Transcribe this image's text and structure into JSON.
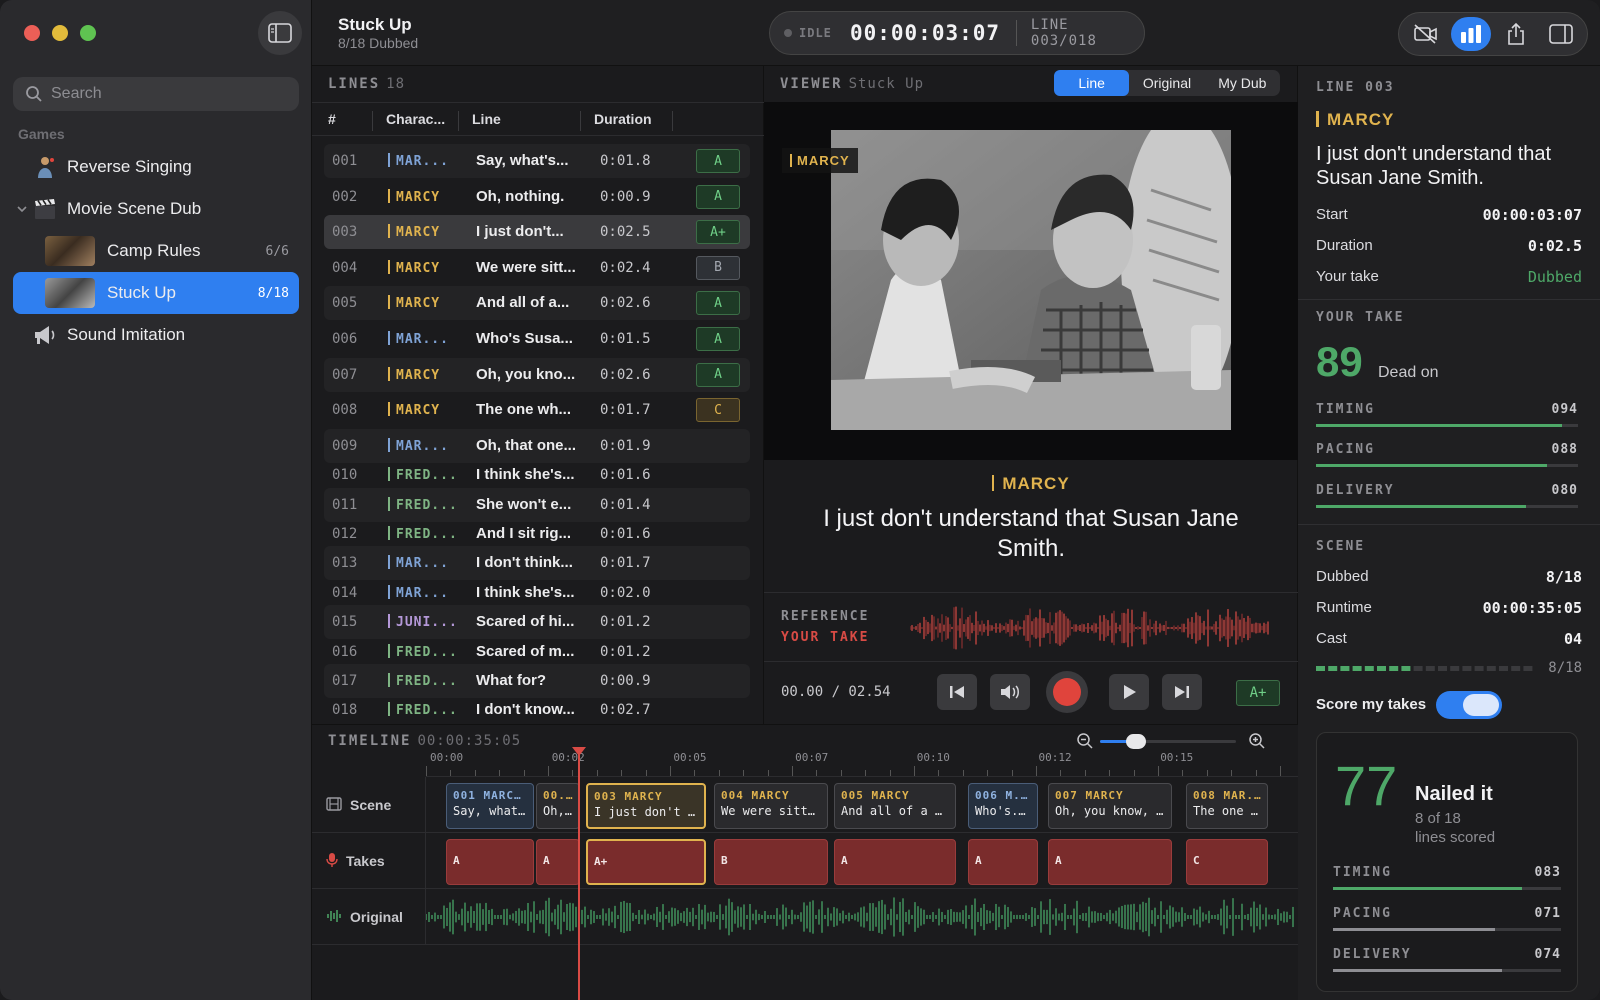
{
  "sidebar": {
    "search_placeholder": "Search",
    "section_title": "Games",
    "items": [
      {
        "label": "Reverse Singing",
        "icon": "singer-icon"
      },
      {
        "label": "Movie Scene Dub",
        "icon": "clapperboard-icon",
        "expanded": true
      },
      {
        "label": "Camp Rules",
        "count": "6/6"
      },
      {
        "label": "Stuck Up",
        "count": "8/18",
        "selected": true
      },
      {
        "label": "Sound Imitation",
        "icon": "megaphone-icon"
      }
    ]
  },
  "header": {
    "title": "Stuck Up",
    "subtitle": "8/18 Dubbed",
    "status": "IDLE",
    "timecode": "00:00:03:07",
    "line_counter": "LINE 003/018"
  },
  "lines": {
    "title": "LINES",
    "count": "18",
    "columns": [
      "#",
      "Charac...",
      "Line",
      "Duration"
    ],
    "rows": [
      {
        "num": "001",
        "character": "MAR...",
        "cls": "c-marb",
        "line": "Say, what's...",
        "duration": "0:01.8",
        "grade": "A"
      },
      {
        "num": "002",
        "character": "MARCY",
        "cls": "c-marcy",
        "line": "Oh, nothing.",
        "duration": "0:00.9",
        "grade": "A"
      },
      {
        "num": "003",
        "character": "MARCY",
        "cls": "c-marcy",
        "line": "I just don't...",
        "duration": "0:02.5",
        "grade": "A+"
      },
      {
        "num": "004",
        "character": "MARCY",
        "cls": "c-marcy",
        "line": "We were sitt...",
        "duration": "0:02.4",
        "grade": "B"
      },
      {
        "num": "005",
        "character": "MARCY",
        "cls": "c-marcy",
        "line": "And all of a...",
        "duration": "0:02.6",
        "grade": "A"
      },
      {
        "num": "006",
        "character": "MAR...",
        "cls": "c-marb",
        "line": "Who's Susa...",
        "duration": "0:01.5",
        "grade": "A"
      },
      {
        "num": "007",
        "character": "MARCY",
        "cls": "c-marcy",
        "line": "Oh, you kno...",
        "duration": "0:02.6",
        "grade": "A"
      },
      {
        "num": "008",
        "character": "MARCY",
        "cls": "c-marcy",
        "line": "The one wh...",
        "duration": "0:01.7",
        "grade": "C"
      },
      {
        "num": "009",
        "character": "MAR...",
        "cls": "c-marb",
        "line": "Oh, that one...",
        "duration": "0:01.9",
        "grade": ""
      },
      {
        "num": "010",
        "character": "FRED...",
        "cls": "c-fred",
        "line": "I think she's...",
        "duration": "0:01.6",
        "grade": ""
      },
      {
        "num": "011",
        "character": "FRED...",
        "cls": "c-fred",
        "line": "She won't e...",
        "duration": "0:01.4",
        "grade": ""
      },
      {
        "num": "012",
        "character": "FRED...",
        "cls": "c-fred",
        "line": "And I sit rig...",
        "duration": "0:01.6",
        "grade": ""
      },
      {
        "num": "013",
        "character": "MAR...",
        "cls": "c-marb",
        "line": "I don't think...",
        "duration": "0:01.7",
        "grade": ""
      },
      {
        "num": "014",
        "character": "MAR...",
        "cls": "c-marb",
        "line": "I think she's...",
        "duration": "0:02.0",
        "grade": ""
      },
      {
        "num": "015",
        "character": "JUNI...",
        "cls": "c-juni",
        "line": "Scared of hi...",
        "duration": "0:01.2",
        "grade": ""
      },
      {
        "num": "016",
        "character": "FRED...",
        "cls": "c-fred",
        "line": "Scared of m...",
        "duration": "0:01.2",
        "grade": ""
      },
      {
        "num": "017",
        "character": "FRED...",
        "cls": "c-fred",
        "line": "What for?",
        "duration": "0:00.9",
        "grade": ""
      },
      {
        "num": "018",
        "character": "FRED...",
        "cls": "c-fred",
        "line": "I don't know...",
        "duration": "0:02.7",
        "grade": ""
      }
    ]
  },
  "viewer": {
    "title": "VIEWER",
    "scene": "Stuck Up",
    "tabs": [
      "Line",
      "Original",
      "My Dub"
    ],
    "video_tag": "MARCY",
    "subtitle_character": "MARCY",
    "subtitle_text": "I just don't understand that Susan Jane Smith.",
    "reference_label": "REFERENCE",
    "your_take_label": "YOUR TAKE",
    "playback_time": "00.00 / 02.54",
    "grade": "A+"
  },
  "inspector": {
    "line_label": "LINE 003",
    "character": "MARCY",
    "text": "I just don't understand that Susan Jane Smith.",
    "rows": [
      {
        "label": "Start",
        "value": "00:00:03:07"
      },
      {
        "label": "Duration",
        "value": "0:02.5"
      },
      {
        "label": "Your take",
        "value": "Dubbed"
      }
    ],
    "take_title": "YOUR TAKE",
    "take_score": "89",
    "take_verdict": "Dead on",
    "take_metrics": [
      {
        "label": "TIMING",
        "value": "094",
        "level": 0.94
      },
      {
        "label": "PACING",
        "value": "088",
        "level": 0.88
      },
      {
        "label": "DELIVERY",
        "value": "080",
        "level": 0.8
      }
    ],
    "scene_title": "SCENE",
    "scene_rows": [
      {
        "label": "Dubbed",
        "value": "8/18"
      },
      {
        "label": "Runtime",
        "value": "00:00:35:05"
      },
      {
        "label": "Cast",
        "value": "04"
      }
    ],
    "scene_progress": "8/18",
    "score_toggle_label": "Score my takes",
    "scene_score": "77",
    "scene_verdict": "Nailed it",
    "scene_scored": "8 of 18",
    "scene_scored_suffix": "lines scored",
    "scene_metrics": [
      {
        "label": "TIMING",
        "value": "083",
        "level": 0.83
      },
      {
        "label": "PACING",
        "value": "071",
        "level": 0.71
      },
      {
        "label": "DELIVERY",
        "value": "074",
        "level": 0.74
      }
    ]
  },
  "timeline": {
    "title": "TIMELINE",
    "runtime": "00:00:35:05",
    "ticks": [
      "00:00",
      "00:02",
      "00:05",
      "00:07",
      "00:10",
      "00:12",
      "00:15"
    ],
    "tracks": [
      "Scene",
      "Takes",
      "Original"
    ],
    "clips": [
      {
        "ch": "001 MARC...",
        "tx": "Say, what'...",
        "style": "blue"
      },
      {
        "ch": "00...",
        "tx": "Oh,...",
        "style": ""
      },
      {
        "ch": "003 MARCY",
        "tx": "I just don't unde...",
        "style": "gold"
      },
      {
        "ch": "004 MARCY",
        "tx": "We were sitting...",
        "style": ""
      },
      {
        "ch": "005 MARCY",
        "tx": "And all of a sudd...",
        "style": ""
      },
      {
        "ch": "006 M...",
        "tx": "Who's...",
        "style": "blue"
      },
      {
        "ch": "007 MARCY",
        "tx": "Oh, you know, th...",
        "style": ""
      },
      {
        "ch": "008 MAR...",
        "tx": "The one w...",
        "style": ""
      }
    ],
    "takes": [
      "A",
      "A",
      "A+",
      "B",
      "A",
      "A",
      "A",
      "C"
    ]
  },
  "colors": {
    "accent": "#2f7ff0",
    "marcy": "#e0b34e",
    "record": "#e0443c",
    "good": "#4ea868"
  }
}
